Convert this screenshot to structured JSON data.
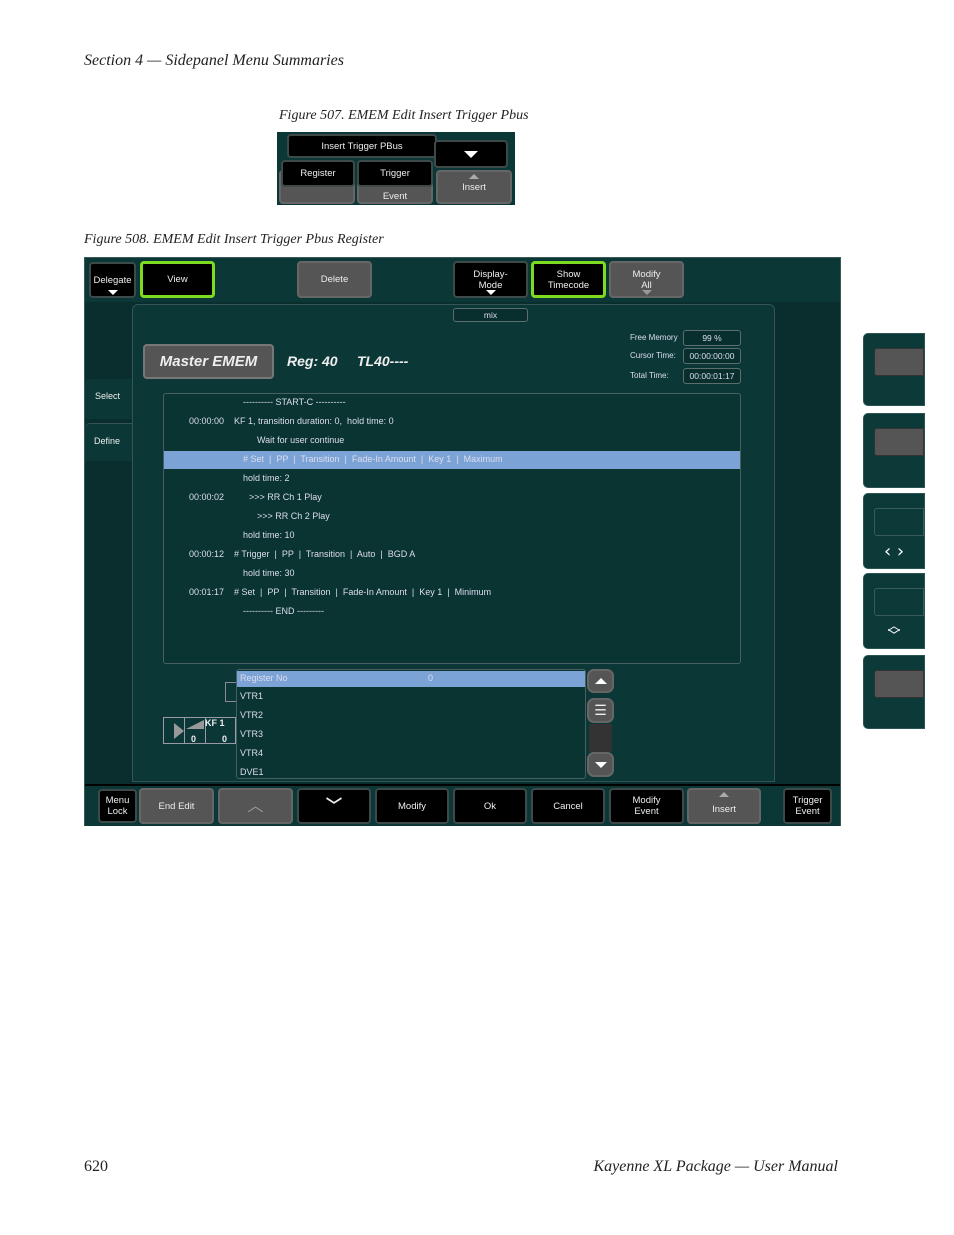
{
  "header": {
    "section": "Section 4 — Sidepanel Menu Summaries"
  },
  "footer": {
    "page_number": "620",
    "manual": "Kayenne XL Package  —  User Manual"
  },
  "figure507": {
    "caption": "Figure 507.  EMEM Edit Insert Trigger Pbus",
    "title_button": "Insert Trigger PBus",
    "register": "Register",
    "trigger": "Trigger",
    "event": "Event",
    "insert": "Insert"
  },
  "figure508": {
    "caption": "Figure 508.  EMEM Edit Insert Trigger Pbus Register",
    "top": {
      "delegate": "Delegate",
      "view": "View",
      "delete": "Delete",
      "display_mode": "Display-\nMode",
      "show_timecode": "Show\nTimecode",
      "modify_all": "Modify\nAll"
    },
    "mix": "mix",
    "master": "Master EMEM",
    "reg": "Reg: 40",
    "tl": "TL40----",
    "info": [
      {
        "label": "Free Memory",
        "value": "99 %"
      },
      {
        "label": "Cursor Time:",
        "value": "00:00:00:00"
      },
      {
        "label": "Total Time:",
        "value": "00:00:01:17"
      }
    ],
    "side_tabs": {
      "select": "Select",
      "define": "Define"
    },
    "timeline": [
      {
        "time": "",
        "text": "---------- START-C ----------",
        "indent": 1
      },
      {
        "time": "00:00:00",
        "text": "KF 1, transition duration: 0,  hold time: 0",
        "indent": 0
      },
      {
        "time": "",
        "text": "Wait for user continue",
        "indent": 2
      },
      {
        "time": "",
        "text": "# Set  |  PP  |  Transition  |  Fade-In Amount  |  Key 1  |  Maximum",
        "indent": 1,
        "selected": true
      },
      {
        "time": "",
        "text": "hold time: 2",
        "indent": 1
      },
      {
        "time": "00:00:02",
        "text": ">>> RR Ch 1 Play",
        "indent": 3
      },
      {
        "time": "",
        "text": ">>> RR Ch 2 Play",
        "indent": 2
      },
      {
        "time": "",
        "text": "hold time: 10",
        "indent": 1
      },
      {
        "time": "00:00:12",
        "text": "# Trigger  |  PP  |  Transition  |  Auto  |  BGD A",
        "indent": 0
      },
      {
        "time": "",
        "text": "hold time: 30",
        "indent": 1
      },
      {
        "time": "00:01:17",
        "text": "# Set  |  PP  |  Transition  |  Fade-In Amount  |  Key 1  |  Minimum",
        "indent": 0
      },
      {
        "time": "",
        "text": "---------- END ---------",
        "indent": 1
      }
    ],
    "register_list": {
      "header_label": "Register No",
      "header_value": "0",
      "items": [
        "VTR1",
        "VTR2",
        "VTR3",
        "VTR4",
        "DVE1"
      ]
    },
    "kf": {
      "label": "KF 1",
      "v1": "0",
      "v2": "0"
    },
    "bottom": {
      "menu_lock": "Menu\nLock",
      "end_edit": "End Edit",
      "modify": "Modify",
      "ok": "Ok",
      "cancel": "Cancel",
      "modify_event": "Modify\nEvent",
      "insert": "Insert",
      "trigger_event": "Trigger\nEvent"
    },
    "colors": {
      "panel": "#0b3837",
      "highlight": "#7ca3d6",
      "active_border": "#7ddc1f"
    }
  }
}
